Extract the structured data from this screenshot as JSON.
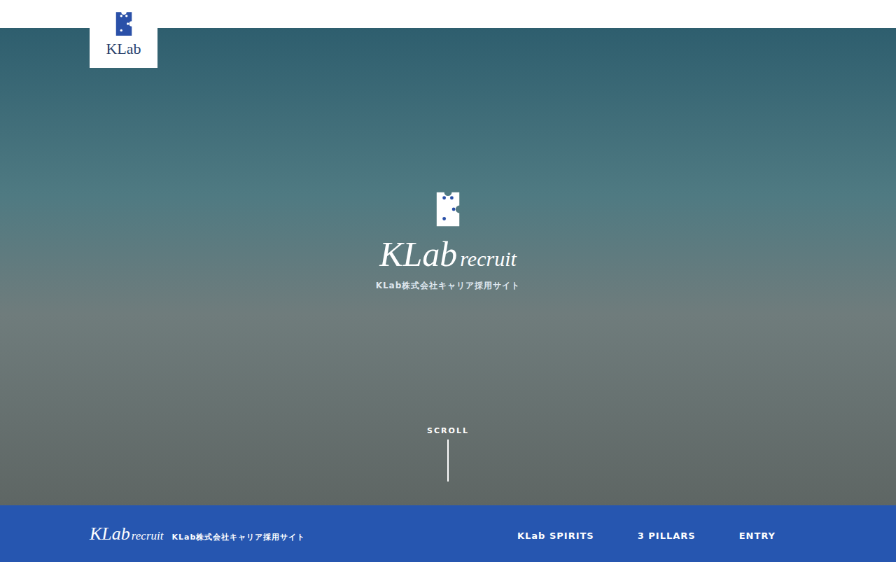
{
  "header": {
    "logo": "KLab"
  },
  "hero": {
    "logo": "KLab",
    "logo_suffix": "recruit",
    "subtitle": "KLab株式会社キャリア採用サイト",
    "scroll": "SCROLL"
  },
  "footer_bar": {
    "logo": "KLab",
    "logo_suffix": "recruit",
    "subtitle": "KLab株式会社キャリア採用サイト",
    "nav": [
      {
        "label": "KLab SPIRITS",
        "selected": false
      },
      {
        "label": "3 PILLARS",
        "selected": false
      },
      {
        "label": "ENTRY",
        "selected": false
      }
    ]
  }
}
